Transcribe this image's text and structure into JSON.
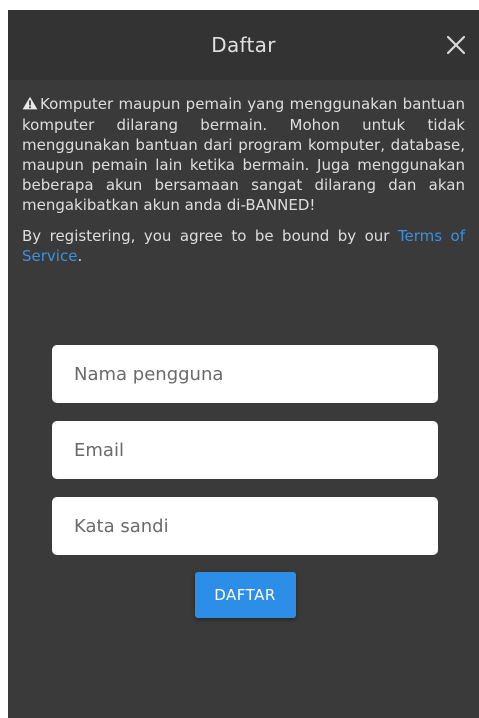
{
  "dialog": {
    "title": "Daftar",
    "close_icon": "close-icon"
  },
  "notice": {
    "warning_icon": "warning-triangle-icon",
    "warning_text": "Komputer maupun pemain yang menggunakan bantuan komputer dilarang bermain. Mohon untuk tidak menggunakan bantuan dari program komputer, database, maupun pemain lain ketika bermain. Juga menggunakan beberapa akun bersamaan sangat dilarang dan akan mengakibatkan akun anda di-BANNED!",
    "agree_prefix": "By registering, you agree to be bound by our ",
    "terms_link": "Terms of Service",
    "agree_suffix": "."
  },
  "form": {
    "username_placeholder": "Nama pengguna",
    "email_placeholder": "Email",
    "password_placeholder": "Kata sandi",
    "submit_label": "DAFTAR"
  },
  "colors": {
    "background": "#3a3a3a",
    "header": "#333333",
    "link": "#3e8fe0",
    "button": "#2d8ee8"
  }
}
